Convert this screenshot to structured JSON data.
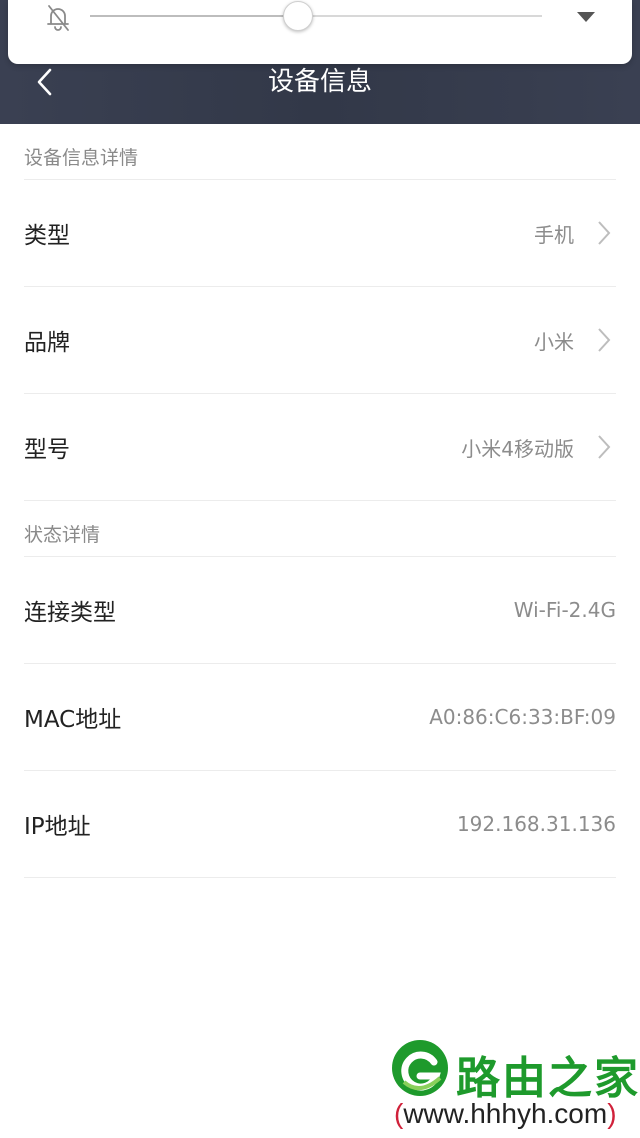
{
  "header": {
    "title": "设备信息",
    "background": "#353b4c"
  },
  "volume_panel": {
    "level_percent": 46,
    "icons": [
      "bell-off-icon",
      "chevron-down-icon"
    ]
  },
  "sections": [
    {
      "title": "设备信息详情",
      "rows": [
        {
          "label": "类型",
          "value": "手机",
          "has_arrow": true
        },
        {
          "label": "品牌",
          "value": "小米",
          "has_arrow": true
        },
        {
          "label": "型号",
          "value": "小米4移动版",
          "has_arrow": true
        }
      ]
    },
    {
      "title": "状态详情",
      "rows": [
        {
          "label": "连接类型",
          "value": "Wi-Fi-2.4G",
          "has_arrow": false
        },
        {
          "label": "MAC地址",
          "value": "A0:86:C6:33:BF:09",
          "has_arrow": false
        },
        {
          "label": "IP地址",
          "value": "192.168.31.136",
          "has_arrow": false
        }
      ]
    }
  ],
  "watermark": {
    "brand": "路由之家",
    "url_open": "(",
    "url": "www.hhhyh.com",
    "url_close": ")",
    "color": "#1e9a2c"
  }
}
